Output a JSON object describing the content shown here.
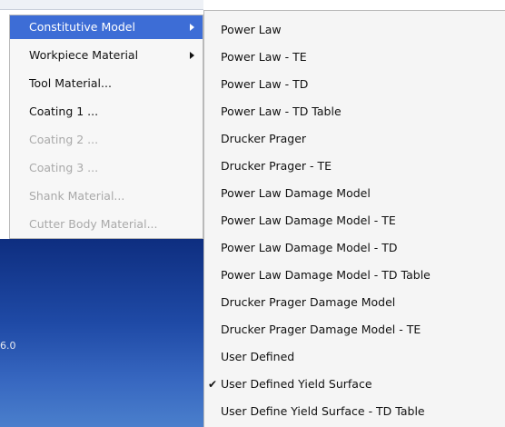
{
  "background": {
    "axis_tick_label": "6.0"
  },
  "parent_menu": {
    "items": [
      {
        "label": "Constitutive Model",
        "has_submenu": true,
        "selected": true,
        "enabled": true
      },
      {
        "label": "Workpiece Material",
        "has_submenu": true,
        "selected": false,
        "enabled": true
      },
      {
        "label": "Tool Material...",
        "has_submenu": false,
        "selected": false,
        "enabled": true
      },
      {
        "label": "Coating 1 ...",
        "has_submenu": false,
        "selected": false,
        "enabled": true
      },
      {
        "label": "Coating 2 ...",
        "has_submenu": false,
        "selected": false,
        "enabled": false
      },
      {
        "label": "Coating 3 ...",
        "has_submenu": false,
        "selected": false,
        "enabled": false
      },
      {
        "label": "Shank Material...",
        "has_submenu": false,
        "selected": false,
        "enabled": false
      },
      {
        "label": "Cutter Body Material...",
        "has_submenu": false,
        "selected": false,
        "enabled": false
      }
    ]
  },
  "submenu": {
    "items": [
      {
        "label": "Power Law",
        "checked": false
      },
      {
        "label": "Power Law - TE",
        "checked": false
      },
      {
        "label": "Power Law - TD",
        "checked": false
      },
      {
        "label": "Power Law - TD Table",
        "checked": false
      },
      {
        "label": "Drucker Prager",
        "checked": false
      },
      {
        "label": "Drucker Prager - TE",
        "checked": false
      },
      {
        "label": "Power Law Damage Model",
        "checked": false
      },
      {
        "label": "Power Law Damage Model - TE",
        "checked": false
      },
      {
        "label": "Power Law Damage Model - TD",
        "checked": false
      },
      {
        "label": "Power Law Damage Model - TD Table",
        "checked": false
      },
      {
        "label": "Drucker Prager Damage Model",
        "checked": false
      },
      {
        "label": "Drucker Prager Damage Model - TE",
        "checked": false
      },
      {
        "label": "User Defined",
        "checked": false
      },
      {
        "label": "User Defined Yield Surface",
        "checked": true
      },
      {
        "label": "User Define Yield Surface - TD Table",
        "checked": false
      }
    ],
    "check_glyph": "✔"
  },
  "colors": {
    "selection": "#3d6dd6",
    "disabled_text": "#a9a9a9",
    "menu_bg": "#f5f5f5"
  }
}
